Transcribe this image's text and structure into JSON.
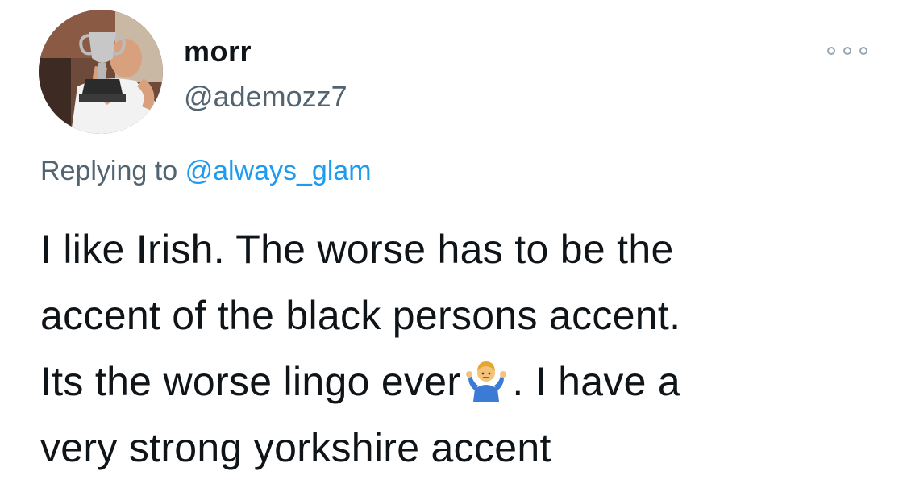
{
  "author": {
    "display_name": "morr",
    "handle": "@ademozz7"
  },
  "reply": {
    "prefix": "Replying to",
    "mention": "@always_glam"
  },
  "tweet": {
    "line1": "I like Irish. The worse has to be the",
    "line2": "accent of the black persons accent.",
    "line3_before_emoji": "Its the worse lingo ever",
    "line3_after_emoji": ". I have a",
    "line4": "very strong yorkshire accent",
    "emoji": "man-shrugging"
  },
  "colors": {
    "text": "#0f1419",
    "secondary": "#536471",
    "link": "#1d9bf0"
  },
  "icons": {
    "more": "more-options-icon"
  }
}
